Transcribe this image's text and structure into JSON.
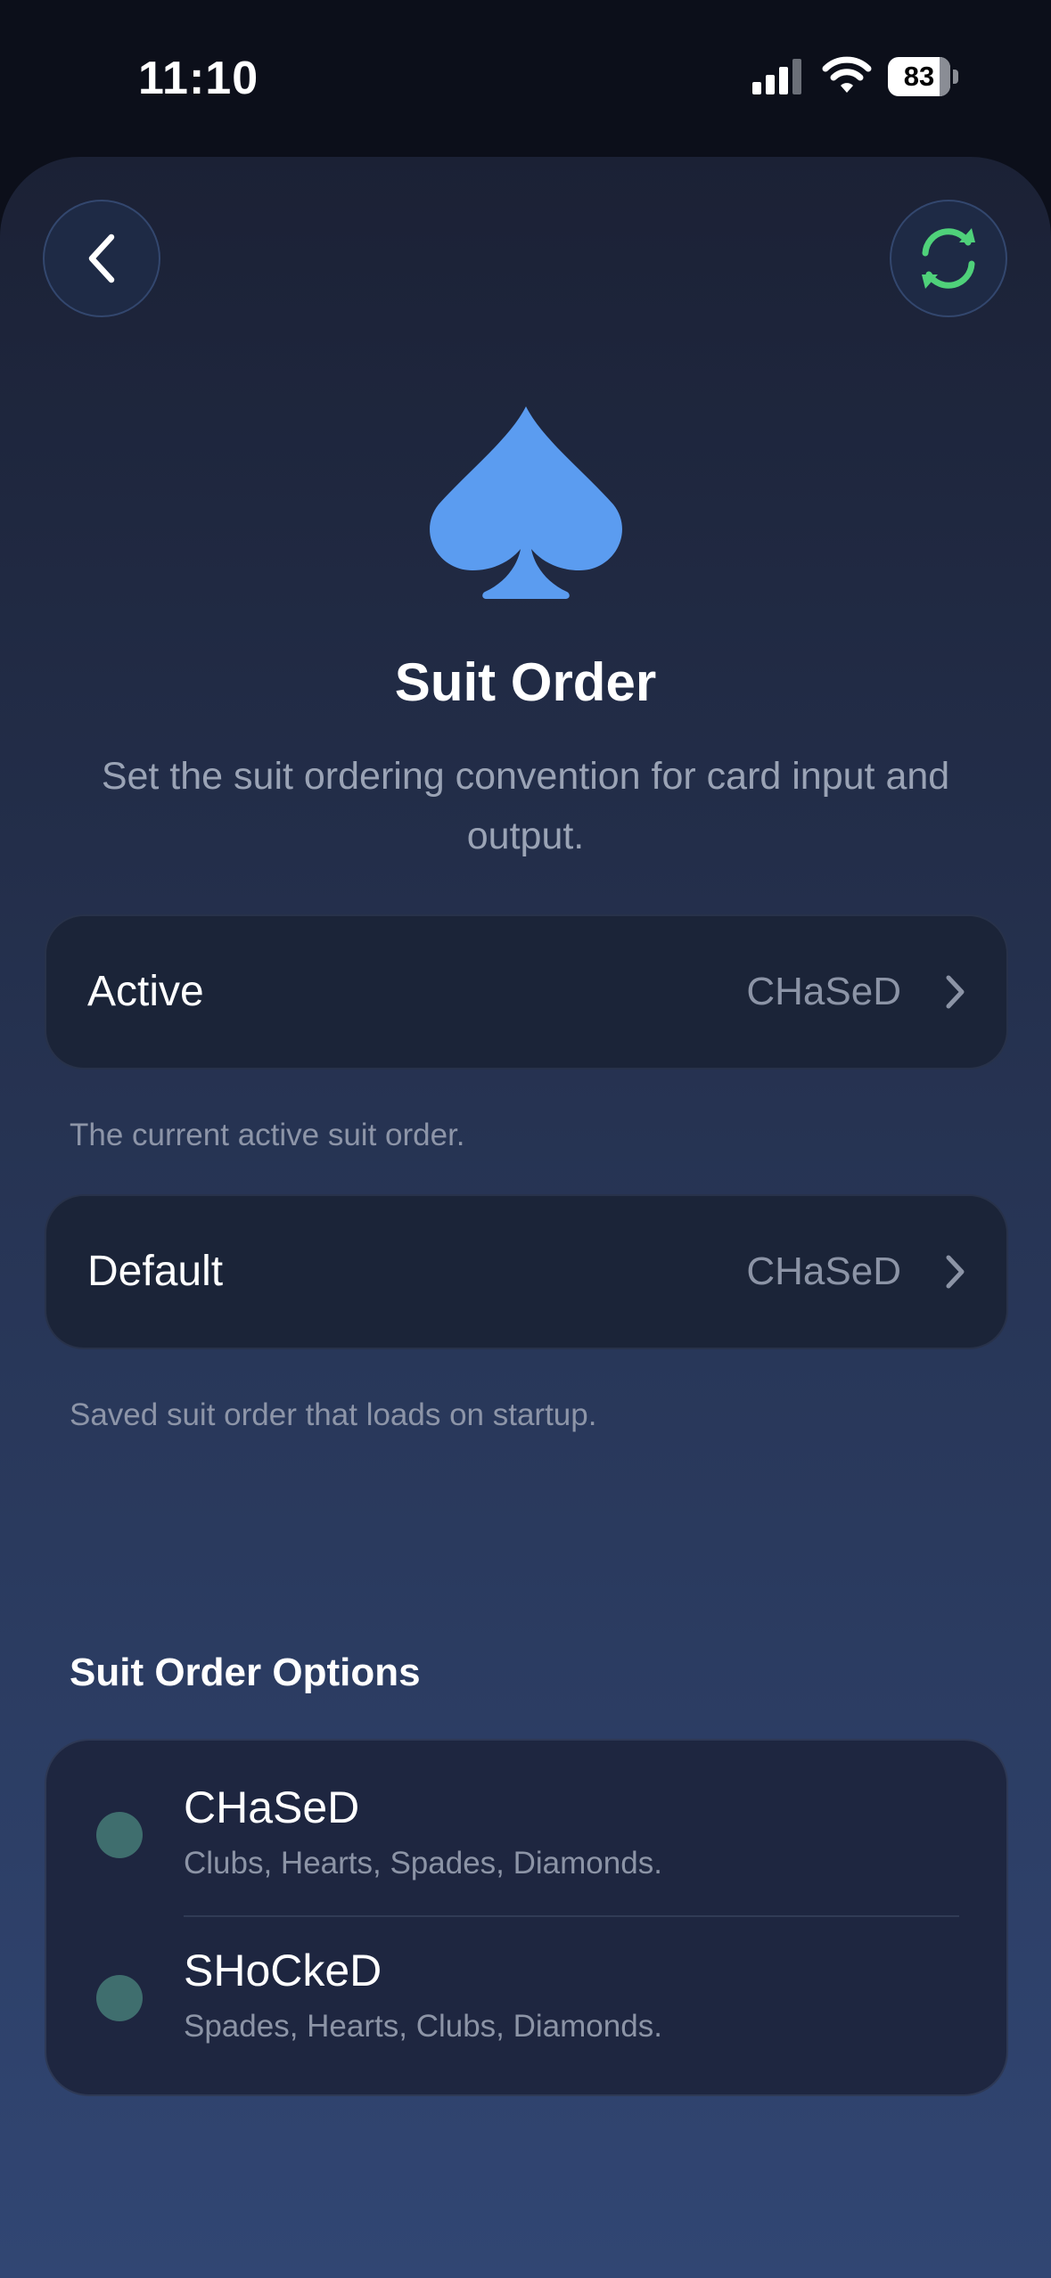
{
  "status_bar": {
    "time": "11:10",
    "battery_level": "83",
    "icons": [
      "signal-icon",
      "wifi-icon",
      "battery-icon"
    ]
  },
  "header": {
    "back_icon": "chevron-left-icon",
    "reset_icon": "refresh-icon",
    "hero_icon": "spade-icon",
    "title": "Suit Order",
    "subtitle": "Set the suit ordering convention for card input and output."
  },
  "settings": {
    "active": {
      "label": "Active",
      "value": "CHaSeD",
      "note": "The current active suit order."
    },
    "default": {
      "label": "Default",
      "value": "CHaSeD",
      "note": "Saved suit order that loads on startup."
    }
  },
  "options": {
    "title": "Suit Order Options",
    "items": [
      {
        "name": "CHaSeD",
        "description": "Clubs, Hearts, Spades, Diamonds."
      },
      {
        "name": "SHoCkeD",
        "description": "Spades, Hearts, Clubs, Diamonds."
      }
    ]
  },
  "colors": {
    "accent_blue": "#5b9cf0",
    "accent_green": "#4fd17a",
    "dot_teal": "#3f6e6e"
  }
}
